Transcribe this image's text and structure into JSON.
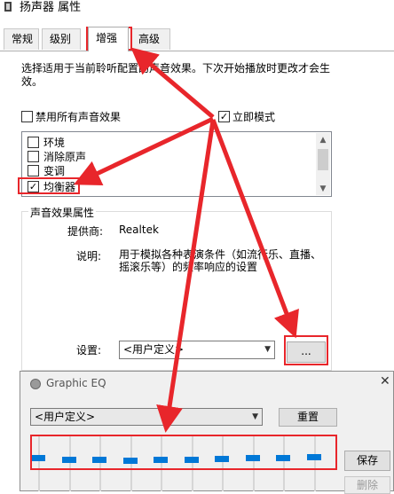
{
  "window": {
    "title": "扬声器 属性",
    "tabs": [
      "常规",
      "级别",
      "增强",
      "高级"
    ],
    "active_tab": "增强"
  },
  "enhance": {
    "description": "选择适用于当前聆听配置的声音效果。下次开始播放时更改才会生效。",
    "disable_all_label": "禁用所有声音效果",
    "disable_all_checked": false,
    "immediate_mode_label": "立即模式",
    "immediate_mode_checked": true,
    "effects": [
      {
        "label": "环境",
        "checked": false
      },
      {
        "label": "消除原声",
        "checked": false
      },
      {
        "label": "变调",
        "checked": false
      },
      {
        "label": "均衡器",
        "checked": true
      }
    ]
  },
  "properties": {
    "group_title": "声音效果属性",
    "provider_label": "提供商:",
    "provider_value": "Realtek",
    "description_label": "说明:",
    "description_value": "用于模拟各种表演条件（如流行乐、直播、摇滚乐等）的频率响应的设置",
    "settings_label": "设置:",
    "settings_value": "<用户定义>",
    "more_button": "..."
  },
  "eq_window": {
    "title": "Graphic EQ",
    "close_glyph": "✕",
    "preset_value": "<用户定义>",
    "reset_label": "重置",
    "save_label": "保存",
    "delete_label": "删除",
    "slider_levels": [
      0.52,
      0.48,
      0.48,
      0.46,
      0.48,
      0.48,
      0.5,
      0.52,
      0.52,
      0.54
    ]
  },
  "annotations": {
    "color": "#e8262b"
  },
  "icons": {
    "title_icon": "speaker-icon",
    "eq_icon": "equalizer-icon",
    "check_glyph": "✓",
    "chevron": "▼",
    "scroll_up": "▲",
    "scroll_down": "▼"
  }
}
